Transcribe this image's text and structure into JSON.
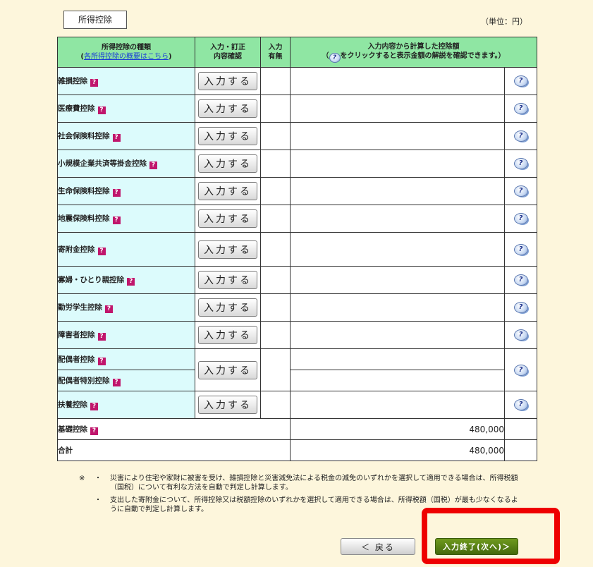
{
  "section_title": "所得控除",
  "unit": "（単位：円）",
  "table": {
    "header": {
      "type_label": "所得控除の種類",
      "overview_link": "各所得控除の概要はこちら",
      "confirm_label_1": "入力・訂正",
      "confirm_label_2": "内容確認",
      "presence_label_1": "入力",
      "presence_label_2": "有無",
      "amount_label": "入力内容から計算した控除額",
      "amount_note_pre": "（",
      "amount_note_post": "をクリックすると表示金額の解説を確認できます。）"
    },
    "input_button_label": "入力する",
    "question_mark": "?",
    "help_icon_glyph": "?",
    "rows": [
      {
        "label": "雑損控除"
      },
      {
        "label": "医療費控除"
      },
      {
        "label": "社会保険料控除"
      },
      {
        "label": "小規模企業共済等掛金控除"
      },
      {
        "label": "生命保険料控除"
      },
      {
        "label": "地震保険料控除"
      },
      {
        "label": "寄附金控除"
      },
      {
        "label": "寡婦・ひとり親控除"
      },
      {
        "label": "勤労学生控除"
      },
      {
        "label": "障害者控除"
      },
      {
        "label": "配偶者控除",
        "label2": "配偶者特別控除"
      },
      {
        "label": "扶養控除"
      }
    ],
    "basic": {
      "label": "基礎控除",
      "amount": "480,000"
    },
    "total": {
      "label": "合計",
      "amount": "480,000"
    }
  },
  "notes": {
    "mark": "※",
    "bullet": "・",
    "items": [
      "災害により住宅や家財に被害を受け、雑損控除と災害減免法による税金の減免のいずれかを選択して適用できる場合は、所得税額（国税）について有利な方法を自動で判定し計算します。",
      "支出した寄附金について、所得控除又は税額控除のいずれかを選択して適用できる場合は、所得税額（国税）が最も少なくなるように自動で判定し計算します。"
    ]
  },
  "buttons": {
    "back": "＜ 戻る",
    "next": "入力終了(次へ)＞"
  },
  "colors": {
    "header_bg": "#8fe6a3",
    "name_bg": "#dcfbfc",
    "page_bg": "#fdf6dc",
    "next_button": "#55800f",
    "highlight": "#ee0000"
  }
}
